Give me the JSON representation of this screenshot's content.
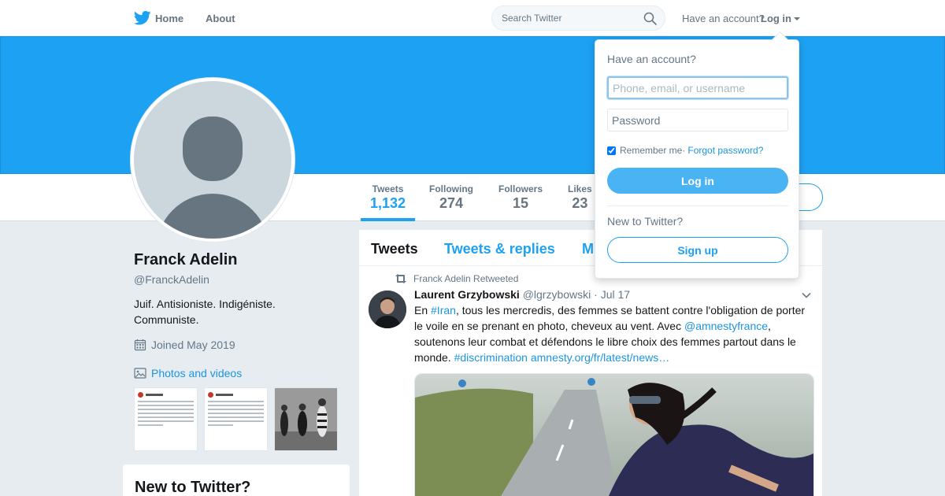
{
  "nav": {
    "home_label": "Home",
    "about_label": "About",
    "search_placeholder": "Search Twitter",
    "have_account": "Have an account?",
    "login_label": "Log in"
  },
  "colors": {
    "brand": "#1da1f2",
    "link": "#1b95e0",
    "text_secondary": "#657786",
    "page_bg": "#e6ecf0"
  },
  "profile": {
    "name": "Franck Adelin",
    "handle": "@FranckAdelin",
    "bio": "Juif. Antisioniste. Indigéniste. Communiste.",
    "joined": "Joined May 2019",
    "photos_label": "Photos and videos",
    "stats": [
      {
        "label": "Tweets",
        "value": "1,132"
      },
      {
        "label": "Following",
        "value": "274"
      },
      {
        "label": "Followers",
        "value": "15"
      },
      {
        "label": "Likes",
        "value": "23"
      }
    ]
  },
  "sidebar_new": {
    "title": "New to Twitter?"
  },
  "timeline": {
    "tabs": [
      "Tweets",
      "Tweets & replies",
      "M"
    ],
    "tweet": {
      "retweeted_by": "Franck Adelin Retweeted",
      "author_name": "Laurent Grzybowski",
      "author_handle": "@lgrzybowski",
      "date": "Jul 17",
      "text_1": "En ",
      "hashtag_1": "#Iran",
      "text_2": ", tous les mercredis, des femmes se battent contre l'obligation de porter le voile en se prenant en photo, cheveux au vent. Avec ",
      "mention_1": "@amnestyfrance",
      "text_3": ", soutenons leur combat et défendons le libre choix des femmes partout dans le monde. ",
      "hashtag_2": "#discrimination",
      "link": "amnesty.org/fr/latest/news…"
    }
  },
  "login_dropdown": {
    "title": "Have an account?",
    "username_placeholder": "Phone, email, or username",
    "password_placeholder": "Password",
    "remember_label": "Remember me",
    "separator": " · ",
    "forgot_label": "Forgot password?",
    "login_button": "Log in",
    "new_label": "New to Twitter?",
    "signup_button": "Sign up"
  },
  "icons": [
    "twitter-bird-icon",
    "search-icon",
    "caret-down-icon",
    "calendar-icon",
    "photo-icon",
    "retweet-icon",
    "chevron-down-icon",
    "default-avatar-icon"
  ]
}
